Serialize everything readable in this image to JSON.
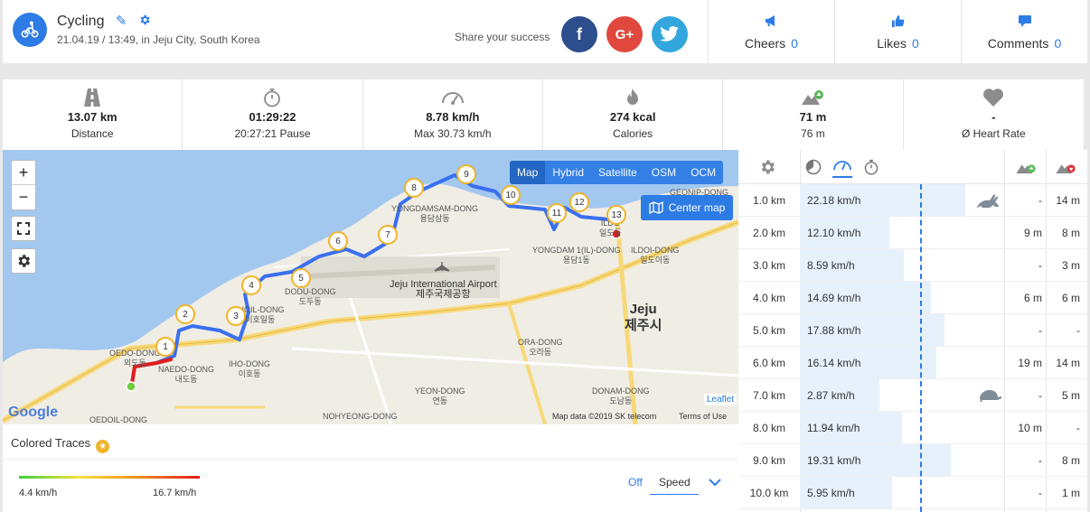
{
  "header": {
    "title": "Cycling",
    "subtitle": "21.04.19 / 13:49, in Jeju City, South Korea",
    "share_label": "Share your success",
    "social": {
      "facebook": "f",
      "google": "G+",
      "twitter": "t"
    },
    "cheers": {
      "label": "Cheers",
      "count": "0"
    },
    "likes": {
      "label": "Likes",
      "count": "0"
    },
    "comments": {
      "label": "Comments",
      "count": "0"
    }
  },
  "stats": [
    {
      "icon": "road-icon",
      "value": "13.07 km",
      "label": "Distance"
    },
    {
      "icon": "stopwatch-icon",
      "value": "01:29:22",
      "label": "20:27:21 Pause"
    },
    {
      "icon": "speedometer-icon",
      "value": "8.78 km/h",
      "label": "Max 30.73 km/h"
    },
    {
      "icon": "flame-icon",
      "value": "274 kcal",
      "label": "Calories"
    },
    {
      "icon": "elevation-up-icon",
      "value": "71 m",
      "label": "76 m"
    },
    {
      "icon": "heart-icon",
      "value": "-",
      "label": "Ø Heart Rate"
    }
  ],
  "map": {
    "zoom_in": "+",
    "zoom_out": "−",
    "types": [
      "Map",
      "Hybrid",
      "Satellite",
      "OSM",
      "OCM"
    ],
    "active_type": "Map",
    "center_button": "Center map",
    "leaflet": "Leaflet",
    "attribution": "Map data ©2019 SK telecom",
    "terms": "Terms of Use",
    "google": "Google",
    "markers": [
      "1",
      "2",
      "3",
      "4",
      "5",
      "6",
      "7",
      "8",
      "9",
      "10",
      "11",
      "12",
      "13"
    ],
    "labels": {
      "airport": "Jeju International Airport",
      "airport_kr": "제주국제공항",
      "city": "Jeju",
      "city_kr": "제주시",
      "yongdamsam": "YONGDAMSAM-DONG",
      "yongdamsam_kr": "용담삼동",
      "yongdam1": "YONGDAM 1(IL)-DONG",
      "yongdam1_kr": "용담1동",
      "ildoi": "ILDOI-DONG",
      "ildoi_kr": "일도이동",
      "ildo": "ILDO",
      "ildo_kr": "일도동",
      "geonip": "GEONIP-DONG",
      "dodu": "DODU-DONG",
      "dodu_kr": "도두동",
      "iho": "IHO-DONG",
      "iho_kr": "이호동",
      "ihoil": "IHOIL-DONG",
      "ihoil_kr": "이호일동",
      "oedo": "OEDO-DONG",
      "oedo_kr": "외도동",
      "naedo": "NAEDO-DONG",
      "naedo_kr": "내도동",
      "ora": "ORA-DONG",
      "ora_kr": "오라동",
      "yeon": "YEON-DONG",
      "yeon_kr": "연동",
      "donam": "DONAM-DONG",
      "donam_kr": "도남동",
      "nohyeong": "NOHYEONG-DONG",
      "oedoil": "OEDOIL-DONG"
    }
  },
  "traces": {
    "title": "Colored Traces",
    "min": "4.4 km/h",
    "max": "16.7 km/h",
    "off": "Off",
    "mode": "Speed",
    "gradient": [
      "#3dd23d",
      "#f5e33a",
      "#f08c1e",
      "#e11c1c"
    ]
  },
  "splits": {
    "rows": [
      {
        "km": "1.0 km",
        "speed": "22.18 km/h",
        "fill": 0.81,
        "up": "-",
        "down": "14 m",
        "badge": "fastest"
      },
      {
        "km": "2.0 km",
        "speed": "12.10 km/h",
        "fill": 0.44,
        "up": "9 m",
        "down": "8 m"
      },
      {
        "km": "3.0 km",
        "speed": "8.59 km/h",
        "fill": 0.51,
        "up": "-",
        "down": "3 m"
      },
      {
        "km": "4.0 km",
        "speed": "14.69 km/h",
        "fill": 0.64,
        "up": "6 m",
        "down": "6 m"
      },
      {
        "km": "5.0 km",
        "speed": "17.88 km/h",
        "fill": 0.71,
        "up": "-",
        "down": "-"
      },
      {
        "km": "6.0 km",
        "speed": "16.14 km/h",
        "fill": 0.67,
        "up": "19 m",
        "down": "14 m"
      },
      {
        "km": "7.0 km",
        "speed": "2.87 km/h",
        "fill": 0.39,
        "up": "-",
        "down": "5 m",
        "badge": "slowest"
      },
      {
        "km": "8.0 km",
        "speed": "11.94 km/h",
        "fill": 0.5,
        "up": "10 m",
        "down": "-"
      },
      {
        "km": "9.0 km",
        "speed": "19.31 km/h",
        "fill": 0.74,
        "up": "-",
        "down": "8 m"
      },
      {
        "km": "10.0 km",
        "speed": "5.95 km/h",
        "fill": 0.45,
        "up": "-",
        "down": "1 m"
      }
    ]
  },
  "colors": {
    "accent": "#2d7be5",
    "route": "#3a6ff0",
    "marker": "#f0b428"
  }
}
